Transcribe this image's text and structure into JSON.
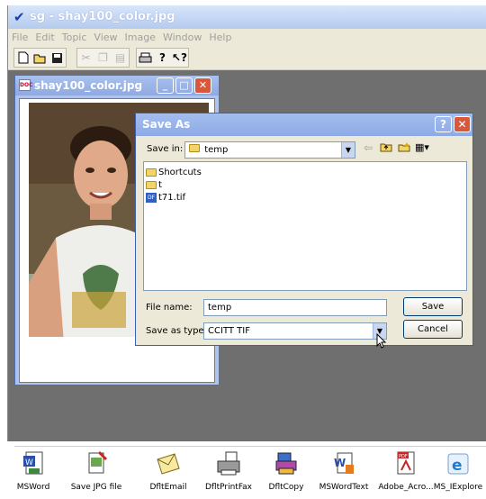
{
  "app": {
    "title": "sg - shay100_color.jpg",
    "menu": [
      "File",
      "Edit",
      "Topic",
      "View",
      "Image",
      "Window",
      "Help"
    ]
  },
  "toolbar": {
    "icons": [
      "new-icon",
      "open-icon",
      "save-icon",
      "cut-icon",
      "copy-icon",
      "paste-icon",
      "print-icon",
      "help-icon",
      "context-help-icon"
    ]
  },
  "image_window": {
    "title": "shay100_color.jpg"
  },
  "dialog": {
    "title": "Save As",
    "help_label": "?",
    "close_label": "✕",
    "save_in_label": "Save in:",
    "save_in_value": "temp",
    "files": [
      {
        "name": "Shortcuts",
        "type": "folder"
      },
      {
        "name": "t",
        "type": "folder"
      },
      {
        "name": "t71.tif",
        "type": "tiff"
      }
    ],
    "file_name_label": "File name:",
    "file_name_value": "temp",
    "save_type_label": "Save as type:",
    "save_type_value": "CCITT TIF",
    "save_button": "Save",
    "cancel_button": "Cancel"
  },
  "taskbar": {
    "items": [
      {
        "label": "MSWord",
        "icon": "word-doc-icon"
      },
      {
        "label": "Save JPG file",
        "icon": "save-jpg-icon"
      },
      {
        "label": "DfltEmail",
        "icon": "email-icon"
      },
      {
        "label": "DfltPrintFax",
        "icon": "printer-fax-icon"
      },
      {
        "label": "DfltCopy",
        "icon": "copy-icon"
      },
      {
        "label": "MSWordText",
        "icon": "word-text-icon"
      },
      {
        "label": "Adobe_Acro...",
        "icon": "pdf-icon"
      },
      {
        "label": "MS_IExplore",
        "icon": "ie-icon"
      }
    ]
  }
}
